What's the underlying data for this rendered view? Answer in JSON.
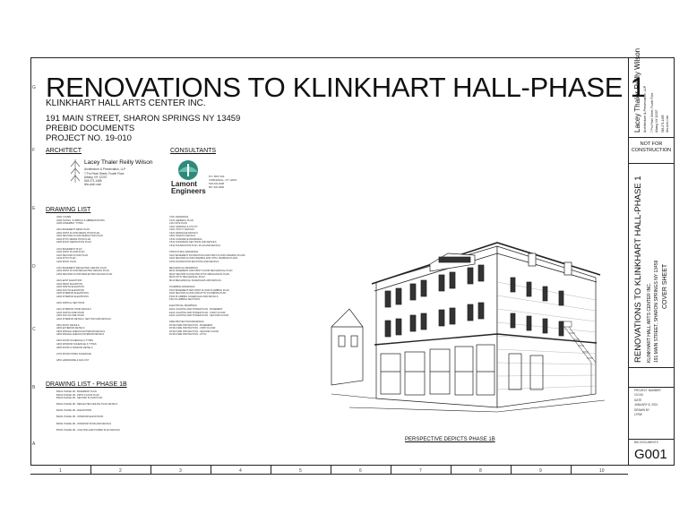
{
  "grid_letters": [
    "G",
    "F",
    "E",
    "D",
    "C",
    "B",
    "A"
  ],
  "grid_numbers": [
    "1",
    "2",
    "3",
    "4",
    "5",
    "6",
    "7",
    "8",
    "9",
    "10"
  ],
  "title": "RENOVATIONS TO KLINKHART HALL-PHASE 1",
  "client": "KLINKHART HALL ARTS CENTER INC.",
  "address": "191 MAIN STREET, SHARON SPRINGS NY 13459",
  "prebid": "PREBID DOCUMENTS",
  "project_no": "PROJECT NO.  19-010",
  "architect": {
    "heading": "ARCHITECT",
    "name": "Lacey Thaler Reilly Wilson",
    "subtitle": "Architecture & Preservation, LLP",
    "line1": "7 Pru Pearl Street, Fourth Floor",
    "line2": "Albany, NY  12207",
    "line3": "518.271.1485",
    "line4": "ltrw-arch.com"
  },
  "consultant": {
    "heading": "CONSULTANTS",
    "name_top": "Lamont",
    "name_bottom": "Engineers",
    "line1": "P.O. BOX 610",
    "line2": "COBLESKILL, NY 12043",
    "line3": "518.234.4028",
    "line4": "607.334.0000"
  },
  "drawing_list_heading": "DRAWING LIST",
  "drawing_list_1b_heading": "DRAWING LIST - PHASE 1B",
  "drawing_list": [
    "G001  COVER",
    "G002  NOTES, SYMBOLS & ABBREVIATIONS",
    "G003  ASSEMBLY TYPES",
    "",
    "A001  BASEMENT DEMO PLAN",
    "A002  FIRST FLOOR DEMOLITION PLAN",
    "A003  SECOND FLOOR DEMOLITION PLAN",
    "A004  ATTIC DEMOLITION PLAN",
    "A005  ROOF DEMOLITION PLAN",
    "",
    "A101  BASEMENT PLAN",
    "A102  FIRST FLOOR PLAN",
    "A103  SECOND FLOOR PLAN",
    "A104  ATTIC PLAN",
    "A105  ROOF PLAN",
    "",
    "A151  BASEMENT REFLECTED CEILING PLAN",
    "A152  FIRST FLOOR REFLECTED CEILING PLAN",
    "A153  SECOND FLOOR REFLECTED CEILING PLAN",
    "",
    "A201  EAST ELEVATION",
    "A202  WEST ELEVATION",
    "A203  NORTH ELEVATION",
    "A204  SOUTH ELEVATION",
    "A205  INTERIOR ELEVATIONS",
    "A206  INTERIOR ELEVATIONS",
    "",
    "A301  PARTIAL SECTIONS",
    "",
    "A401  INTERIOR STAIR DETAILS",
    "A402  NORTH FIRE STAIR",
    "A403  SOUTH FIRE STAIR",
    "A404  INTERIOR DETAILS, SECTION AND DETAILS",
    "",
    "A501  ROOF DETAILS",
    "A502  EXTERIOR DETAILS",
    "A503  MISCELLANEOUS EXTERIOR DETAILS",
    "A504  MISCELLANEOUS INTERIOR DETAILS",
    "",
    "A601  DOOR SCHEDULE & TYPES",
    "A602  WINDOW SCHEDULE & TYPES",
    "A603  DOOR & WINDOW DETAILS",
    "",
    "A701  ROOM FINISH SCHEDULE",
    "",
    "A801  HARDWARE & ADA LIST"
  ],
  "drawing_list_right": [
    "CIVIL DRAWINGS",
    "C101  GENERAL PLAN",
    "C111  SITE PLAN",
    "C201  GRADING & UTILITY",
    "C301  UTILITY DETAILS",
    "C401  DRAINAGE DETAILS",
    "C501  TRAFFIC DETAILS",
    "C510  CONCRETE DRAWINGS",
    "C511  CONCRETE SECTIONS AND DETAILS",
    "C512  FOUNDATION PLAN, PLAN AND DETAILS",
    "",
    "STRUCTURAL DRAWINGS",
    "S101  BASEMENT FOUNDATION AND FIRST FLOOR FRAMING PLANS",
    "S102  SECOND FLOOR FRAMING AND ATTIC FRAMING PLANS",
    "S103  FOUNDATION SECTIONS AND DETAILS",
    "",
    "MECHANICAL DRAWINGS",
    "M101  BASEMENT AND FIRST FLOOR MECHANICAL PLAN",
    "M102  SECOND FLOOR AND ATTIC MECHANICAL PLAN",
    "M103  ATTIC MECHANICAL PLAN",
    "M110  MECHANICAL SCHEDULES AND DETAILS",
    "",
    "PLUMBING DRAWINGS",
    "P101  BASEMENT AND FIRST FLOOR PLUMBING PLAN",
    "P102  SECOND FLOOR AND ATTIC PLUMBING PLAN",
    "P103  PLUMBING SCHEDULES AND DETAILS",
    "P111  PLUMBING SECTIONS",
    "",
    "ELECTRICAL DRAWINGS",
    "E101  LIGHTING AND POWER PLAN - BASEMENT",
    "E102  LIGHTING AND POWER PLAN - FIRST FLOOR",
    "E103  LIGHTING AND POWER PLAN - SECOND FLOOR",
    "",
    "FIRE PROTECTION DRAWINGS",
    "FP100  FIRE PROTECTION - BASEMENT",
    "FP101  FIRE PROTECTION - FIRST FLOOR",
    "FP102  FIRE PROTECTION - SECOND FLOOR",
    "FP103  FIRE PROTECTION - ATTIC"
  ],
  "drawing_list_1b": [
    "B1101  PHASE 1B - BASEMENT PLAN",
    "B1102  PHASE 1B - FIRST FLOOR PLAN",
    "B1103  PHASE 1B - SECOND FLOOR PLAN",
    "",
    "B1104  PHASE 1B - REFLECTED CEILING PLAN DETAILS",
    "",
    "B1201  PHASE 1B - ELEVATIONS",
    "",
    "B2201  PHASE 1B - INTERIOR ELEVATIONS",
    "",
    "B2301  PHASE 1B - INTERIOR STAIR AND DETAILS",
    "",
    "B7201  PHASE 1B - LIGHTING AND POWER PLAN DETAILS"
  ],
  "perspective_caption": "PERSPECTIVE DEPICTS PHASE 1B",
  "title_block": {
    "firm": "Lacey Thaler Reilly Wilson",
    "firm_sub": "Architecture & Preservation, LLP",
    "firm_addr1": "7 Pru Pearl Street, Fourth Floor",
    "firm_addr2": "Albany, NY  12207",
    "firm_phone": "518.271.1485",
    "firm_web": "ltrw-arch.com",
    "not_for_construction": "NOT FOR\nCONSTRUCTION",
    "project_title": "RENOVATIONS TO KLINKHART HALL-PHASE 1",
    "project_client": "KLINKHART HALL ARTS CENTER INC.",
    "project_address": "191 MAIN STREET, SHARON SPRINGS NY 13459",
    "sheet_title": "COVER SHEET",
    "project_number_label": "PROJECT NUMBER",
    "project_number": "19-010",
    "date_label": "DATE",
    "date": "JANUARY 8, 2021",
    "drawn_by_label": "DRAWN BY",
    "drawn_by": "LTRW",
    "bid_label": "BID DOCUMENTS",
    "sheet_number": "G001"
  }
}
